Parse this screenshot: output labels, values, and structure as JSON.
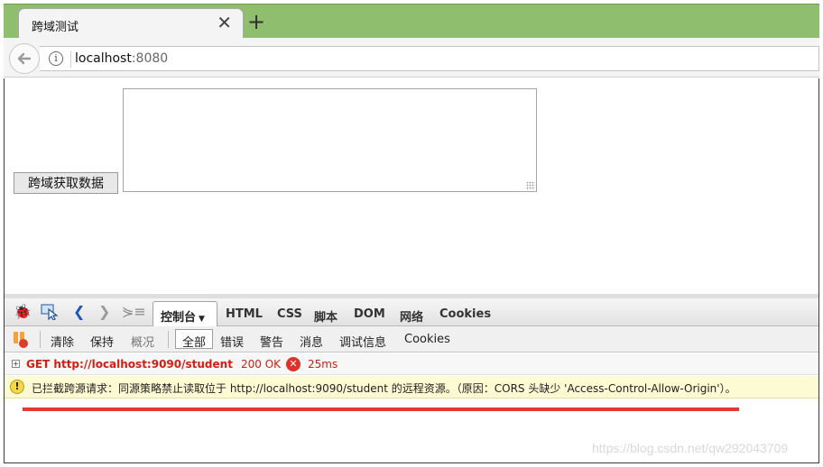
{
  "browser": {
    "tab_title": "跨域测试",
    "tab_close": "✕",
    "new_tab": "+",
    "url_host": "localhost",
    "url_port": ":8080"
  },
  "page": {
    "fetch_button_label": "跨域获取数据",
    "result_value": ""
  },
  "devtools": {
    "tabs": [
      "控制台",
      "HTML",
      "CSS",
      "脚本",
      "DOM",
      "网络",
      "Cookies"
    ],
    "active_tab": "控制台",
    "subbar": {
      "clear": "清除",
      "persist": "保持",
      "profile": "概况",
      "all": "全部",
      "errors": "错误",
      "warnings": "警告",
      "info": "消息",
      "debug_info": "调试信息",
      "cookies": "Cookies"
    },
    "request": {
      "method_url": "GET http://localhost:9090/student",
      "status": "200 OK",
      "time": "25ms"
    },
    "warning_message": "已拦截跨源请求：同源策略禁止读取位于 http://localhost:9090/student 的远程资源。（原因：CORS 头缺少 'Access-Control-Allow-Origin'）。"
  },
  "watermark": "https://blog.csdn.net/qw292043709",
  "colors": {
    "tab_strip": "#8fbe6e",
    "error_red": "#d11f12",
    "warning_bg": "#fdfbd3",
    "annotation_red": "#e53935"
  }
}
